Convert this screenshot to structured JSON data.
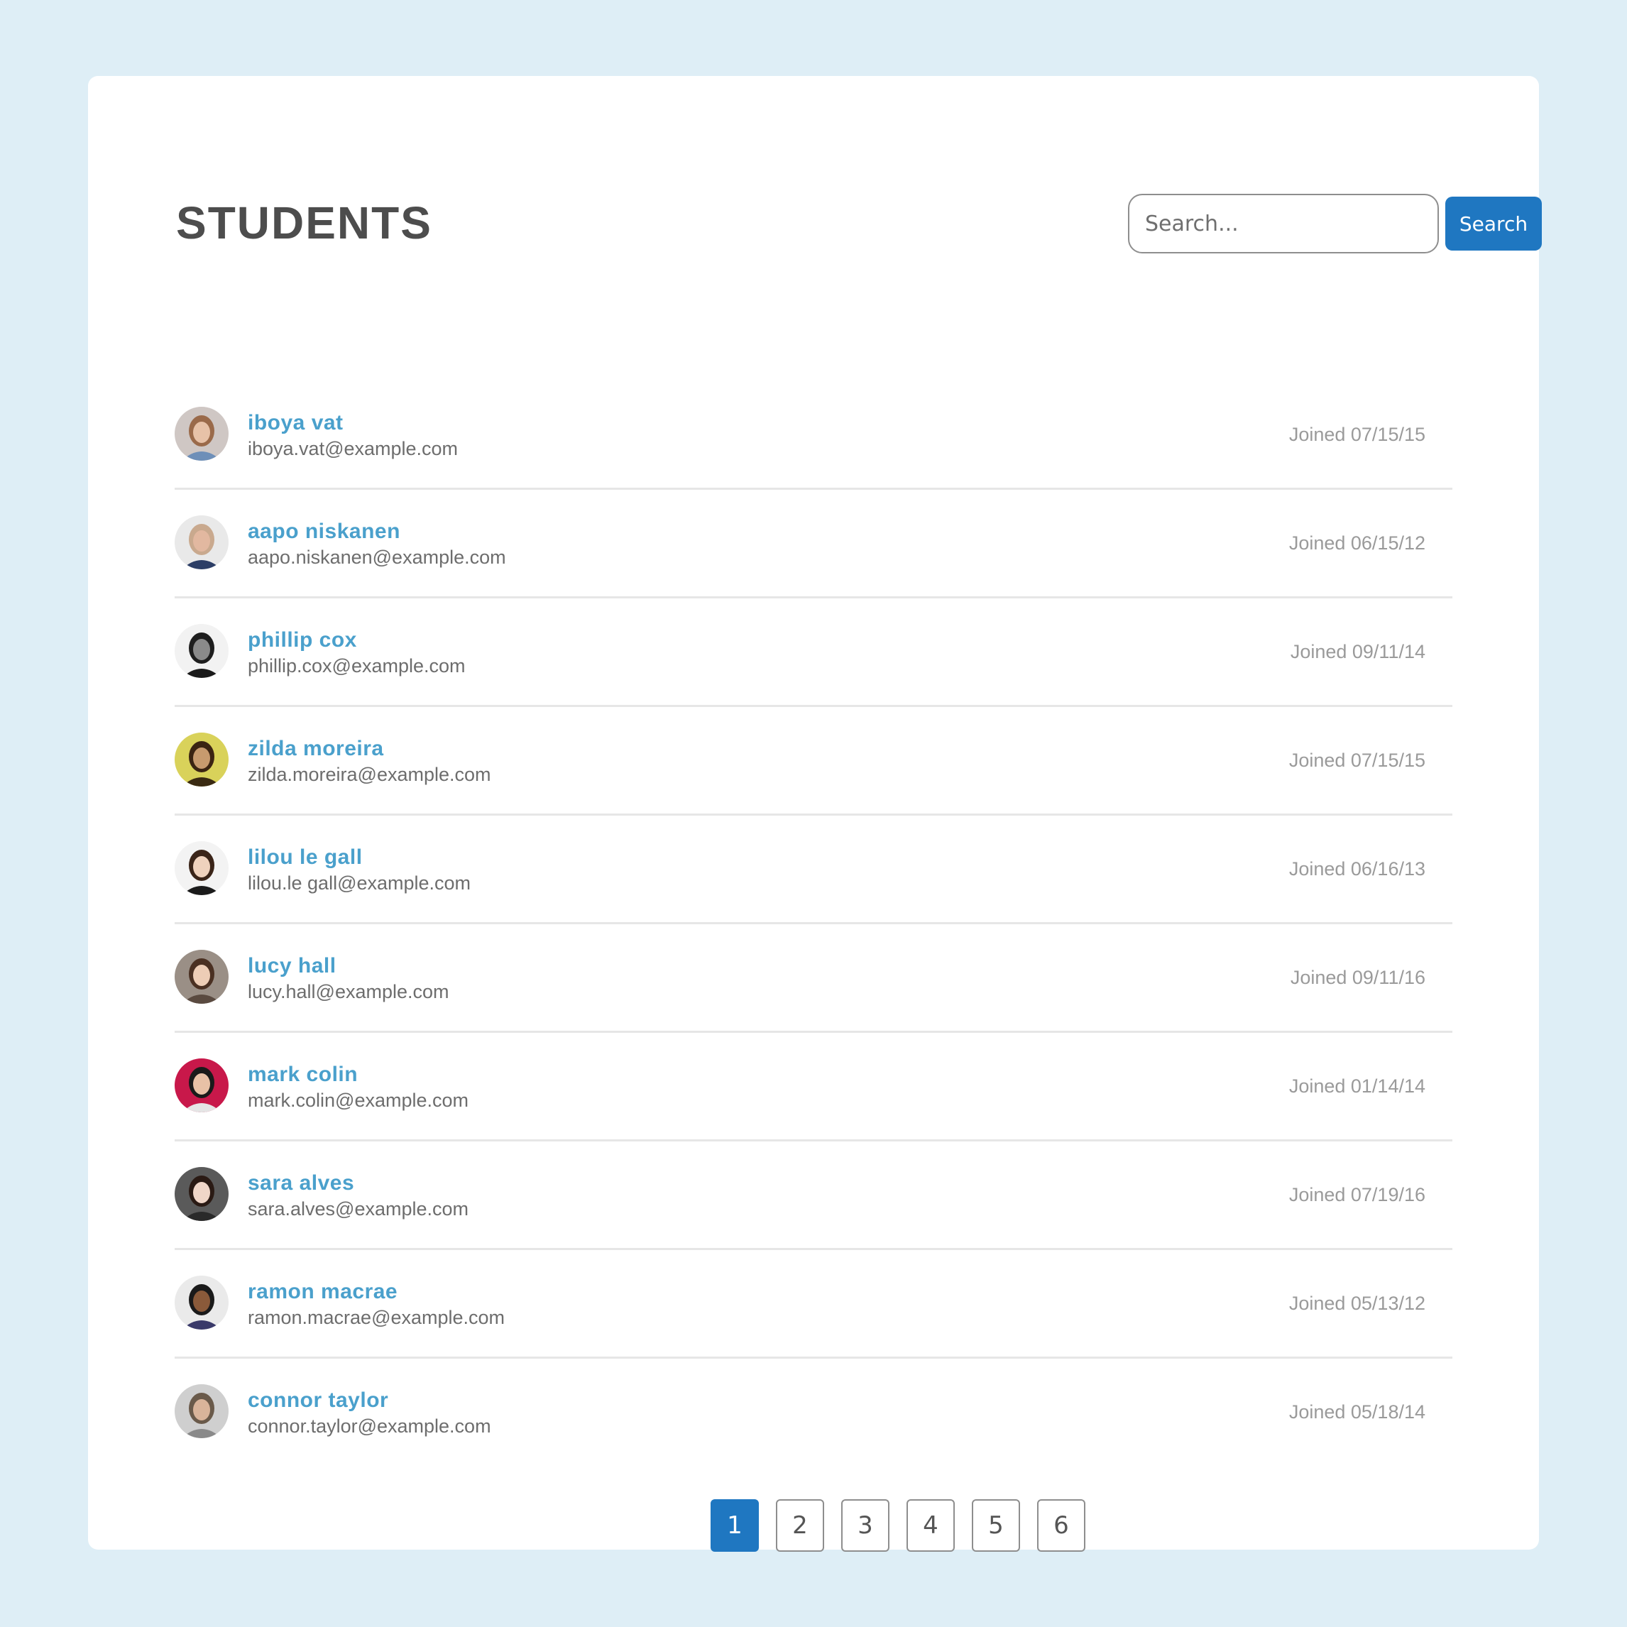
{
  "header": {
    "title": "STUDENTS"
  },
  "search": {
    "placeholder": "Search...",
    "button_label": "Search"
  },
  "students": [
    {
      "name": "iboya vat",
      "email": "iboya.vat@example.com",
      "joined": "Joined 07/15/15",
      "avatar": {
        "bg": "#cfc7c4",
        "hair": "#9a6a4a",
        "skin": "#e7c2a8",
        "shirt": "#6e8fb8"
      }
    },
    {
      "name": "aapo niskanen",
      "email": "aapo.niskanen@example.com",
      "joined": "Joined 06/15/12",
      "avatar": {
        "bg": "#e9e9e9",
        "hair": "#c9a98e",
        "skin": "#e2b8a0",
        "shirt": "#2c3e66"
      }
    },
    {
      "name": "phillip cox",
      "email": "phillip.cox@example.com",
      "joined": "Joined 09/11/14",
      "avatar": {
        "bg": "#f2f2f2",
        "hair": "#1e1e1e",
        "skin": "#8a8a8a",
        "shirt": "#1a1a1a"
      }
    },
    {
      "name": "zilda moreira",
      "email": "zilda.moreira@example.com",
      "joined": "Joined 07/15/15",
      "avatar": {
        "bg": "#d9d25a",
        "hair": "#3b2412",
        "skin": "#c79a6e",
        "shirt": "#3a2a12"
      }
    },
    {
      "name": "lilou le gall",
      "email": "lilou.le gall@example.com",
      "joined": "Joined 06/16/13",
      "avatar": {
        "bg": "#f3f3f3",
        "hair": "#3a2418",
        "skin": "#efd2bd",
        "shirt": "#1b1b1b"
      }
    },
    {
      "name": "lucy hall",
      "email": "lucy.hall@example.com",
      "joined": "Joined 09/11/16",
      "avatar": {
        "bg": "#9a8f86",
        "hair": "#4a3022",
        "skin": "#edcdb6",
        "shirt": "#5a4a40"
      }
    },
    {
      "name": "mark colin",
      "email": "mark.colin@example.com",
      "joined": "Joined 01/14/14",
      "avatar": {
        "bg": "#c8184a",
        "hair": "#1a1a1a",
        "skin": "#e8c1a6",
        "shirt": "#e5e5e5"
      }
    },
    {
      "name": "sara alves",
      "email": "sara.alves@example.com",
      "joined": "Joined 07/19/16",
      "avatar": {
        "bg": "#5a5a5a",
        "hair": "#2a1a14",
        "skin": "#f0d6c8",
        "shirt": "#2a2a2a"
      }
    },
    {
      "name": "ramon macrae",
      "email": "ramon.macrae@example.com",
      "joined": "Joined 05/13/12",
      "avatar": {
        "bg": "#eaeaea",
        "hair": "#1a1a1a",
        "skin": "#8a5a3a",
        "shirt": "#3a3a6a"
      }
    },
    {
      "name": "connor taylor",
      "email": "connor.taylor@example.com",
      "joined": "Joined 05/18/14",
      "avatar": {
        "bg": "#cfcfcf",
        "hair": "#6a5a4a",
        "skin": "#d9b49a",
        "shirt": "#8a8a8a"
      }
    }
  ],
  "pagination": {
    "pages": [
      "1",
      "2",
      "3",
      "4",
      "5",
      "6"
    ],
    "current": "1"
  },
  "colors": {
    "accent": "#1f77c1",
    "name": "#4aa0cc",
    "background": "#deeef6"
  }
}
